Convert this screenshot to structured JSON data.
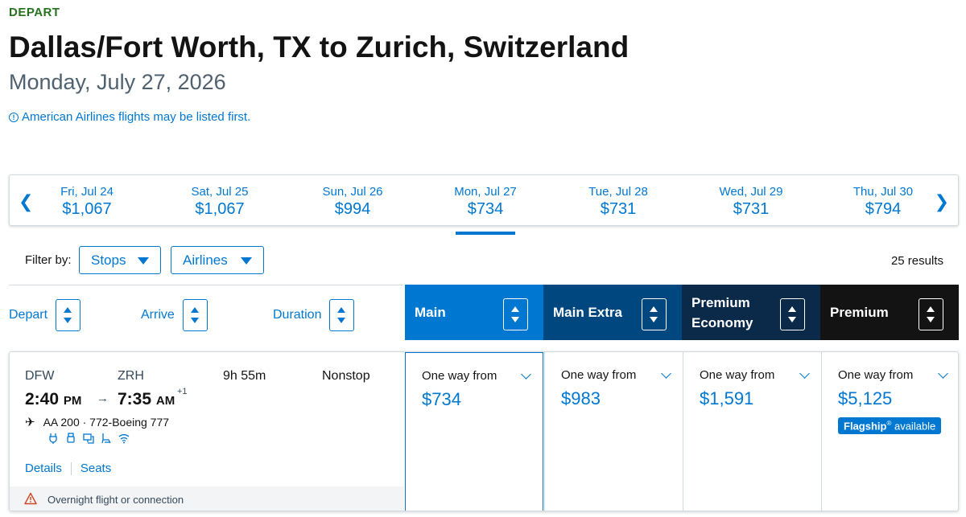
{
  "header": {
    "depart_label": "DEPART",
    "route_title": "Dallas/Fort Worth, TX to Zurich, Switzerland",
    "date": "Monday, July 27, 2026",
    "notice": "American Airlines flights may be listed first."
  },
  "date_strip": [
    {
      "day": "Fri, Jul 24",
      "price": "$1,067"
    },
    {
      "day": "Sat, Jul 25",
      "price": "$1,067"
    },
    {
      "day": "Sun, Jul 26",
      "price": "$994"
    },
    {
      "day": "Mon, Jul 27",
      "price": "$734",
      "selected": true
    },
    {
      "day": "Tue, Jul 28",
      "price": "$731"
    },
    {
      "day": "Wed, Jul 29",
      "price": "$731"
    },
    {
      "day": "Thu, Jul 30",
      "price": "$794"
    }
  ],
  "filters": {
    "label": "Filter by:",
    "stops": "Stops",
    "airlines": "Airlines",
    "results": "25 results"
  },
  "sort": {
    "depart": "Depart",
    "arrive": "Arrive",
    "duration": "Duration"
  },
  "cabins": [
    {
      "name": "Main",
      "color": "#0078d2"
    },
    {
      "name": "Main Extra",
      "color": "#00467f"
    },
    {
      "name": "Premium Economy",
      "line1": "Premium",
      "line2": "Economy",
      "color": "#0b2a4a"
    },
    {
      "name": "Premium",
      "color": "#131313"
    }
  ],
  "flight": {
    "origin": "DFW",
    "destination": "ZRH",
    "depart_time": "2:40",
    "depart_ampm": "PM",
    "arrive_time": "7:35",
    "arrive_ampm": "AM",
    "day_offset": "+1",
    "duration": "9h 55m",
    "stops": "Nonstop",
    "flight_info": "AA 200 · 772-Boeing 777",
    "amenities": [
      "power-icon",
      "usb-icon",
      "entertainment-icon",
      "seat-icon",
      "wifi-icon"
    ],
    "details_link": "Details",
    "seats_link": "Seats",
    "overnight_notice": "Overnight flight or connection",
    "fares": [
      {
        "from": "One way from",
        "price": "$734"
      },
      {
        "from": "One way from",
        "price": "$983"
      },
      {
        "from": "One way from",
        "price": "$1,591"
      },
      {
        "from": "One way from",
        "price": "$5,125",
        "badge_bold": "Flagship",
        "badge_sup": "®",
        "badge_rest": " available"
      }
    ]
  }
}
